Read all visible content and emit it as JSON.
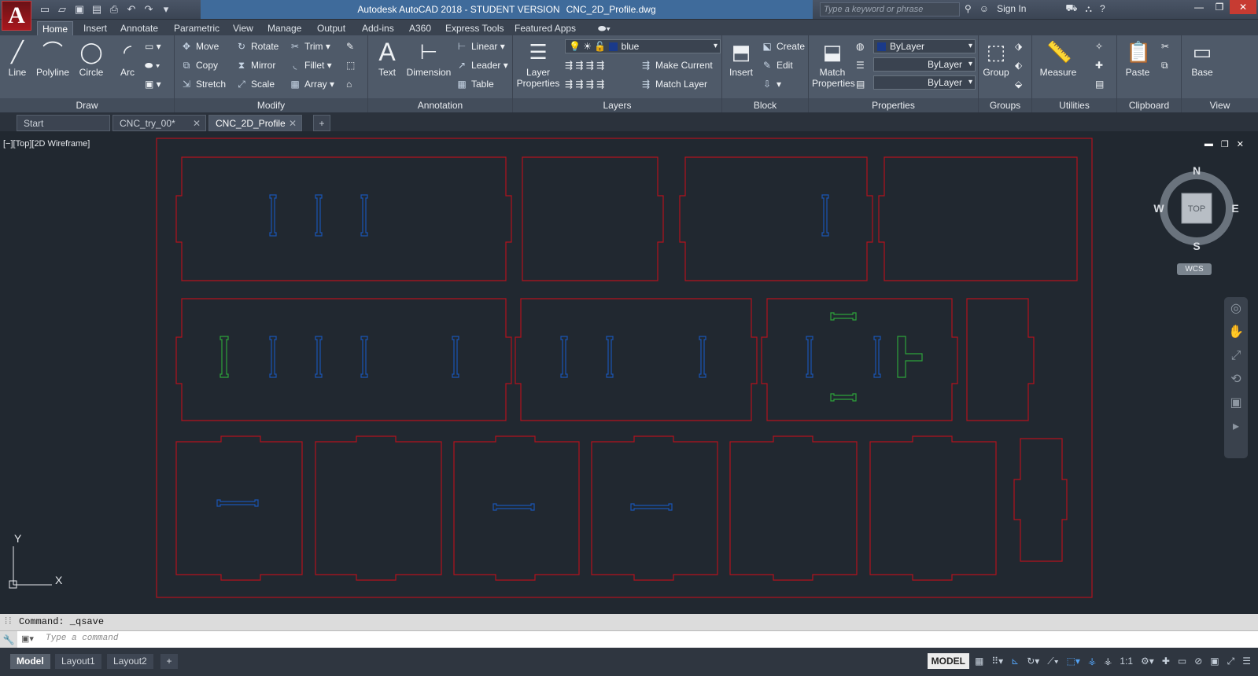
{
  "titlebar": {
    "app_letter": "A",
    "title": "Autodesk AutoCAD 2018 - STUDENT VERSION",
    "filename": "CNC_2D_Profile.dwg",
    "search_placeholder": "Type a keyword or phrase",
    "sign_in": "Sign In",
    "help": "?"
  },
  "ribbon_tabs": [
    "Home",
    "Insert",
    "Annotate",
    "Parametric",
    "View",
    "Manage",
    "Output",
    "Add-ins",
    "A360",
    "Express Tools",
    "Featured Apps"
  ],
  "ribbon": {
    "draw": {
      "title": "Draw",
      "line": "Line",
      "polyline": "Polyline",
      "circle": "Circle",
      "arc": "Arc"
    },
    "modify": {
      "title": "Modify",
      "move": "Move",
      "rotate": "Rotate",
      "trim": "Trim",
      "copy": "Copy",
      "mirror": "Mirror",
      "fillet": "Fillet",
      "stretch": "Stretch",
      "scale": "Scale",
      "array": "Array"
    },
    "annotation": {
      "title": "Annotation",
      "text": "Text",
      "dimension": "Dimension",
      "linear": "Linear",
      "leader": "Leader",
      "table": "Table"
    },
    "layers": {
      "title": "Layers",
      "layer_properties_1": "Layer",
      "layer_properties_2": "Properties",
      "current_layer": "blue",
      "make_current": "Make Current",
      "match_layer": "Match Layer"
    },
    "block": {
      "title": "Block",
      "insert": "Insert",
      "create": "Create",
      "edit": "Edit"
    },
    "properties": {
      "title": "Properties",
      "match_1": "Match",
      "match_2": "Properties",
      "color": "ByLayer",
      "linetype": "ByLayer",
      "lineweight": "ByLayer"
    },
    "groups": {
      "title": "Groups",
      "group": "Group"
    },
    "utilities": {
      "title": "Utilities",
      "measure": "Measure"
    },
    "clipboard": {
      "title": "Clipboard",
      "paste": "Paste"
    },
    "view": {
      "title": "View",
      "base": "Base"
    }
  },
  "doc_tabs": [
    "Start",
    "CNC_try_00*",
    "CNC_2D_Profile"
  ],
  "viewport": {
    "label": "[−][Top][2D Wireframe]",
    "compass": {
      "n": "N",
      "s": "S",
      "e": "E",
      "w": "W",
      "top": "TOP"
    },
    "wcs": "WCS",
    "ucs_x": "X",
    "ucs_y": "Y"
  },
  "colors": {
    "red": "#b3121c",
    "blue": "#1a55b4",
    "green": "#2ea33a",
    "bg": "#212830"
  },
  "command": {
    "history": "Command: _qsave",
    "placeholder": "Type a command"
  },
  "status": {
    "tabs": [
      "Model",
      "Layout1",
      "Layout2"
    ],
    "model": "MODEL",
    "scale": "1:1"
  }
}
